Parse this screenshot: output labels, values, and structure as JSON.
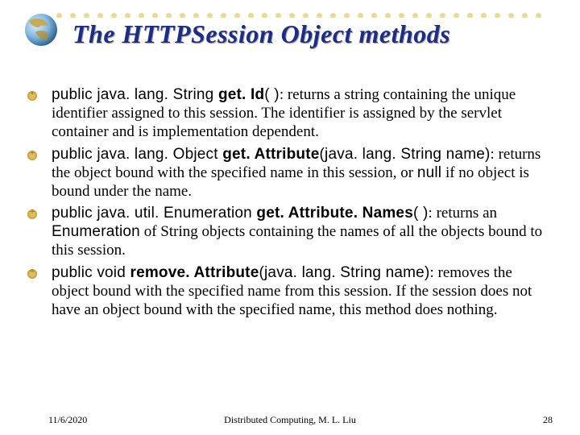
{
  "title": "The HTTPSession Object methods",
  "bullets": [
    {
      "sig_pre": "public java. lang. String ",
      "sig_bold": "get. Id",
      "sig_post": "( )",
      "pre": ": ",
      "desc": "returns a string containing the unique identifier assigned to this session. The identifier is assigned by the servlet container and is implementation dependent."
    },
    {
      "sig_pre": "public java. lang. Object ",
      "sig_bold": "get. Attribute",
      "sig_post": "(java. lang. String name)",
      "pre": ": ",
      "mid1": "returns the object bound with the specified name in this session, or ",
      "code1": "null",
      "desc": " if no object is bound under the name."
    },
    {
      "sig_pre": "public java. util. Enumeration ",
      "sig_bold": "get. Attribute. Names",
      "sig_post": "( )",
      "pre": ": ",
      "code1": "",
      "mid1": "returns an ",
      "code2": "Enumeration",
      "desc": " of String objects containing the names of all the objects bound to this session."
    },
    {
      "sig_pre": "public void ",
      "sig_bold": "remove. Attribute",
      "sig_post": "(java. lang. String name)",
      "pre": ": ",
      "desc": "removes the object bound with the specified name from this session. If the session does not have an object bound with the specified name, this method does nothing."
    }
  ],
  "footer": {
    "date": "11/6/2020",
    "credit": "Distributed Computing, M. L. Liu",
    "page": "28"
  }
}
